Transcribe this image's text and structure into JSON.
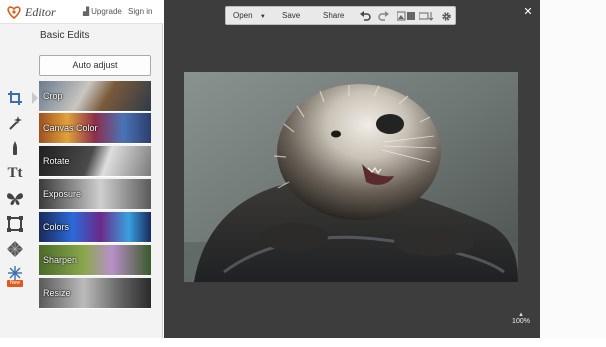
{
  "app": {
    "logo_text": "Editor",
    "upgrade_label": "Upgrade",
    "signin_label": "Sign in"
  },
  "panel": {
    "title": "Basic Edits",
    "auto_adjust_label": "Auto adjust"
  },
  "tools": [
    {
      "icon": "crop-icon"
    },
    {
      "icon": "magic-wand-icon"
    },
    {
      "icon": "touch-up-icon"
    },
    {
      "icon": "text-icon"
    },
    {
      "icon": "butterfly-icon"
    },
    {
      "icon": "frame-icon"
    },
    {
      "icon": "texture-icon"
    },
    {
      "icon": "snowflake-icon",
      "badge": "New"
    }
  ],
  "edits": [
    {
      "label": "Crop"
    },
    {
      "label": "Canvas Color"
    },
    {
      "label": "Rotate"
    },
    {
      "label": "Exposure"
    },
    {
      "label": "Colors"
    },
    {
      "label": "Sharpen"
    },
    {
      "label": "Resize"
    }
  ],
  "toolbar": {
    "open_label": "Open",
    "save_label": "Save",
    "share_label": "Share"
  },
  "workspace": {
    "zoom": "100%"
  },
  "colors": {
    "workspace_bg": "#3d3d3d",
    "brand_orange": "#e05a1c"
  }
}
